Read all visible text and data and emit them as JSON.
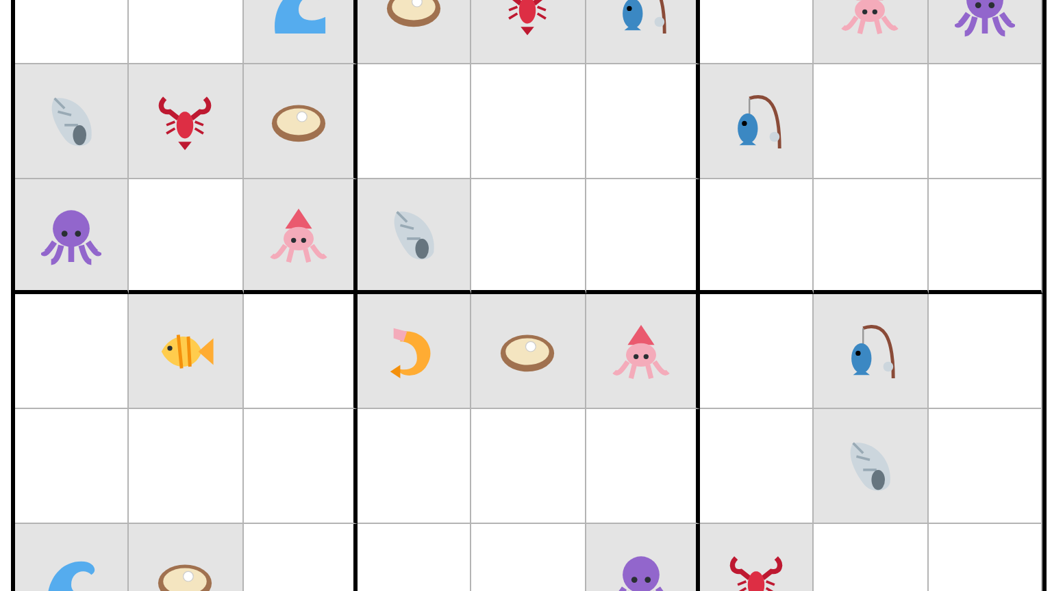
{
  "rows": [
    {
      "cells": [
        {
          "kind": "empty",
          "given": false
        },
        {
          "kind": "empty",
          "given": false
        },
        {
          "kind": "wave",
          "given": true
        },
        {
          "kind": "oyster",
          "given": true
        },
        {
          "kind": "lobster",
          "given": true
        },
        {
          "kind": "fishing",
          "given": true
        },
        {
          "kind": "empty",
          "given": false
        },
        {
          "kind": "squid",
          "given": true
        },
        {
          "kind": "octopus",
          "given": true
        }
      ]
    },
    {
      "cells": [
        {
          "kind": "shell",
          "given": true
        },
        {
          "kind": "lobster",
          "given": true
        },
        {
          "kind": "oyster",
          "given": true
        },
        {
          "kind": "empty",
          "given": false
        },
        {
          "kind": "empty",
          "given": false
        },
        {
          "kind": "empty",
          "given": false
        },
        {
          "kind": "fishing",
          "given": true
        },
        {
          "kind": "empty",
          "given": false
        },
        {
          "kind": "empty",
          "given": false
        }
      ]
    },
    {
      "cells": [
        {
          "kind": "octopus",
          "given": true
        },
        {
          "kind": "empty",
          "given": false
        },
        {
          "kind": "squid",
          "given": true
        },
        {
          "kind": "shell",
          "given": true
        },
        {
          "kind": "empty",
          "given": false
        },
        {
          "kind": "empty",
          "given": false
        },
        {
          "kind": "empty",
          "given": false
        },
        {
          "kind": "empty",
          "given": false
        },
        {
          "kind": "empty",
          "given": false
        }
      ]
    },
    {
      "cells": [
        {
          "kind": "empty",
          "given": false
        },
        {
          "kind": "fish",
          "given": true
        },
        {
          "kind": "empty",
          "given": false
        },
        {
          "kind": "shrimp",
          "given": true
        },
        {
          "kind": "oyster",
          "given": true
        },
        {
          "kind": "squid",
          "given": true
        },
        {
          "kind": "empty",
          "given": false
        },
        {
          "kind": "fishing",
          "given": true
        },
        {
          "kind": "empty",
          "given": false
        }
      ]
    },
    {
      "cells": [
        {
          "kind": "empty",
          "given": false
        },
        {
          "kind": "empty",
          "given": false
        },
        {
          "kind": "empty",
          "given": false
        },
        {
          "kind": "empty",
          "given": false
        },
        {
          "kind": "empty",
          "given": false
        },
        {
          "kind": "empty",
          "given": false
        },
        {
          "kind": "empty",
          "given": false
        },
        {
          "kind": "shell",
          "given": true
        },
        {
          "kind": "empty",
          "given": false
        }
      ]
    },
    {
      "cells": [
        {
          "kind": "wave",
          "given": true
        },
        {
          "kind": "oyster",
          "given": true
        },
        {
          "kind": "empty",
          "given": false
        },
        {
          "kind": "empty",
          "given": false
        },
        {
          "kind": "empty",
          "given": false
        },
        {
          "kind": "octopus",
          "given": true
        },
        {
          "kind": "lobster",
          "given": true
        },
        {
          "kind": "empty",
          "given": false
        },
        {
          "kind": "empty",
          "given": false
        }
      ]
    }
  ]
}
